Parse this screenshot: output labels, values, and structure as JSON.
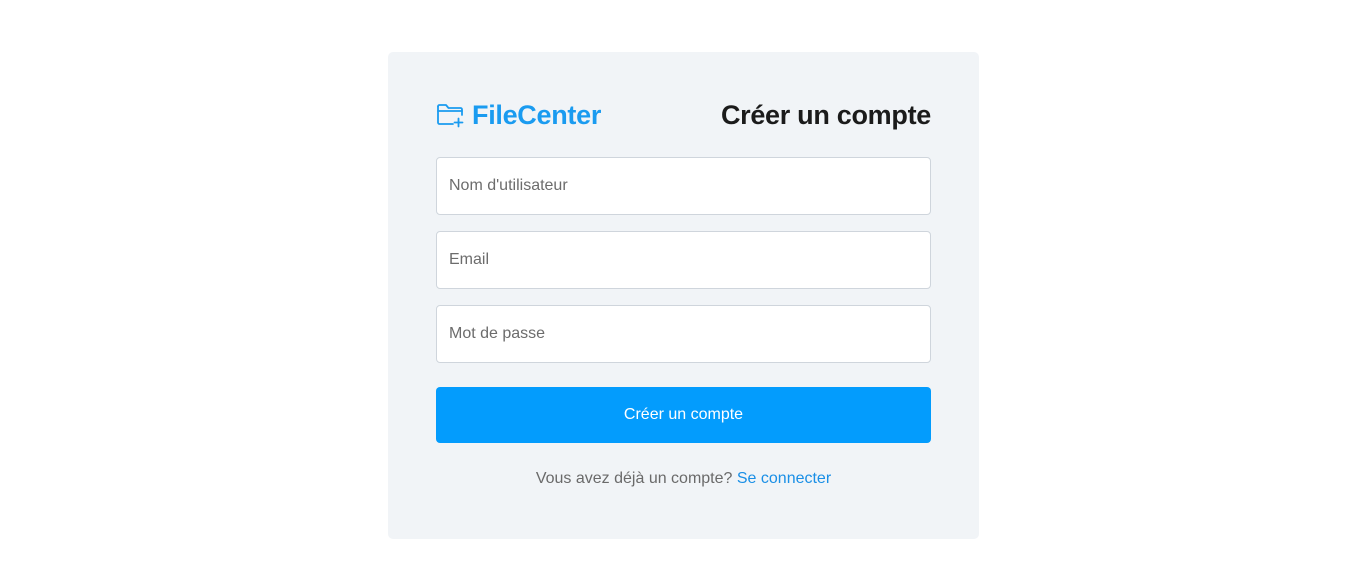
{
  "brand": {
    "name": "FileCenter",
    "icon": "folder-plus-icon",
    "color": "#1a9bf0"
  },
  "page": {
    "heading": "Créer un compte"
  },
  "form": {
    "username_placeholder": "Nom d'utilisateur",
    "username_value": "",
    "email_placeholder": "Email",
    "email_value": "",
    "password_placeholder": "Mot de passe",
    "password_value": "",
    "submit_label": "Créer un compte",
    "submit_color": "#039cfd"
  },
  "footer": {
    "prompt": "Vous avez déjà un compte?",
    "link_label": "Se connecter",
    "link_color": "#1a8fe6"
  }
}
